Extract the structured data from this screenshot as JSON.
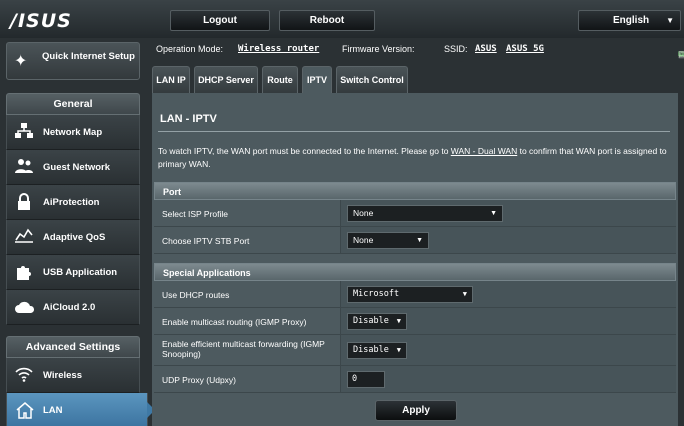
{
  "header": {
    "logo": "/ISUS",
    "logout_label": "Logout",
    "reboot_label": "Reboot",
    "language": "English"
  },
  "status": {
    "op_mode_label": "Operation Mode:",
    "op_mode_value": "Wireless router",
    "fw_label": "Firmware Version:",
    "ssid_label": "SSID:",
    "ssid_1": "ASUS",
    "ssid_2": "ASUS_5G"
  },
  "sidebar": {
    "qis_label": "Quick Internet Setup",
    "general_title": "General",
    "general_items": [
      {
        "label": "Network Map",
        "icon": "network-map-icon"
      },
      {
        "label": "Guest Network",
        "icon": "guest-network-icon"
      },
      {
        "label": "AiProtection",
        "icon": "lock-icon"
      },
      {
        "label": "Adaptive QoS",
        "icon": "qos-icon"
      },
      {
        "label": "USB Application",
        "icon": "puzzle-icon"
      },
      {
        "label": "AiCloud 2.0",
        "icon": "cloud-icon"
      }
    ],
    "advanced_title": "Advanced Settings",
    "advanced_items": [
      {
        "label": "Wireless",
        "icon": "wifi-icon"
      },
      {
        "label": "LAN",
        "icon": "home-icon",
        "active": true
      }
    ]
  },
  "tabs": [
    "LAN IP",
    "DHCP Server",
    "Route",
    "IPTV",
    "Switch Control"
  ],
  "active_tab": "IPTV",
  "main": {
    "title": "LAN - IPTV",
    "desc_before": "To watch IPTV, the WAN port must be connected to the Internet. Please go to ",
    "desc_link": "WAN - Dual WAN",
    "desc_after": " to confirm that WAN port is assigned to primary WAN.",
    "port_section": {
      "title": "Port",
      "rows": [
        {
          "label": "Select ISP Profile",
          "value": "None"
        },
        {
          "label": "Choose IPTV STB Port",
          "value": "None"
        }
      ]
    },
    "special_section": {
      "title": "Special Applications",
      "rows": [
        {
          "label": "Use DHCP routes",
          "value": "Microsoft"
        },
        {
          "label": "Enable multicast routing (IGMP Proxy)",
          "value": "Disable"
        },
        {
          "label": "Enable efficient multicast forwarding (IGMP Snooping)",
          "value": "Disable"
        },
        {
          "label": "UDP Proxy (Udpxy)",
          "value": "0"
        }
      ]
    },
    "apply_label": "Apply"
  }
}
